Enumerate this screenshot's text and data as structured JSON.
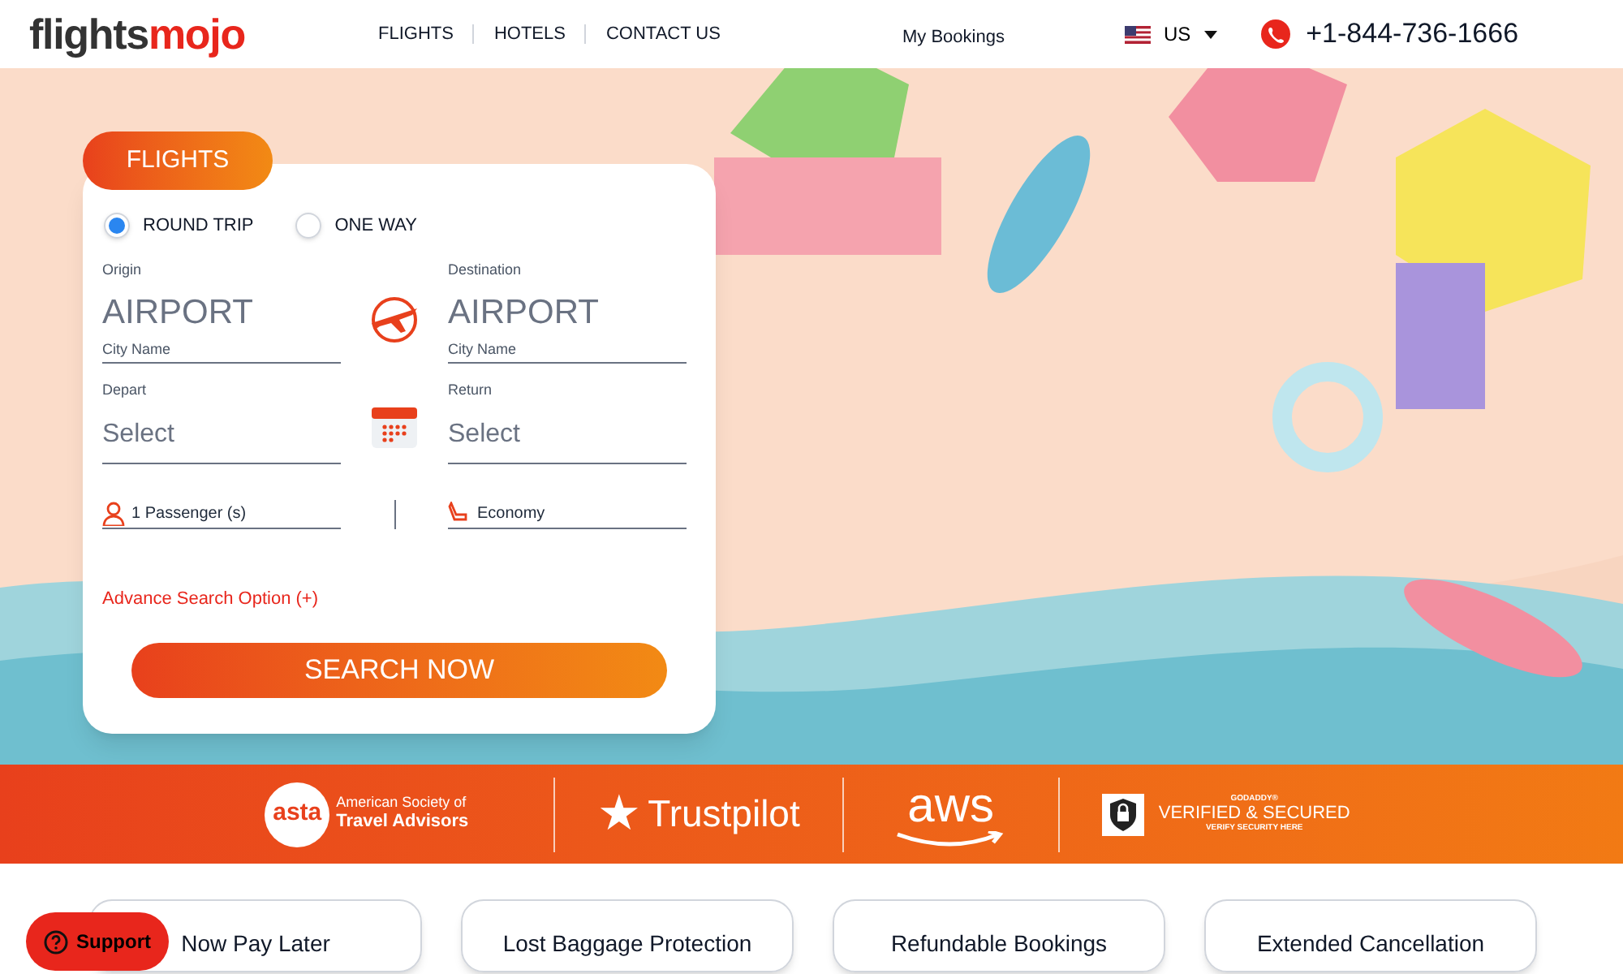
{
  "header": {
    "logo": {
      "first": "flights",
      "second": "mojo"
    },
    "nav": [
      {
        "label": "FLIGHTS"
      },
      {
        "label": "HOTELS"
      },
      {
        "label": "CONTACT US"
      }
    ],
    "my_bookings": "My Bookings",
    "country": "US",
    "phone": "+1-844-736-1666"
  },
  "search_form": {
    "tab": "FLIGHTS",
    "trip_types": [
      {
        "label": "ROUND TRIP",
        "selected": true
      },
      {
        "label": "ONE WAY",
        "selected": false
      }
    ],
    "origin": {
      "label": "Origin",
      "placeholder": "AIRPORT",
      "hint": "City Name"
    },
    "destination": {
      "label": "Destination",
      "placeholder": "AIRPORT",
      "hint": "City Name"
    },
    "depart": {
      "label": "Depart",
      "placeholder": "Select"
    },
    "return": {
      "label": "Return",
      "placeholder": "Select"
    },
    "passengers": "1 Passenger (s)",
    "cabin": "Economy",
    "advance_link": "Advance Search Option (+)",
    "search_button": "SEARCH NOW"
  },
  "trust_badges": [
    {
      "kind": "asta",
      "mark": "asta",
      "lines": [
        "American Society of",
        "Travel Advisors"
      ]
    },
    {
      "kind": "trustpilot",
      "mark": "★",
      "lines": [
        "Trustpilot"
      ]
    },
    {
      "kind": "aws",
      "mark": "aws"
    },
    {
      "kind": "godaddy",
      "lines": [
        "GODADDY®",
        "VERIFIED & SECURED",
        "VERIFY SECURITY HERE"
      ]
    }
  ],
  "features": [
    {
      "title": "Now Pay Later"
    },
    {
      "title": "Lost Baggage Protection"
    },
    {
      "title": "Refundable Bookings"
    },
    {
      "title": "Extended Cancellation"
    }
  ],
  "support_button": "Support"
}
